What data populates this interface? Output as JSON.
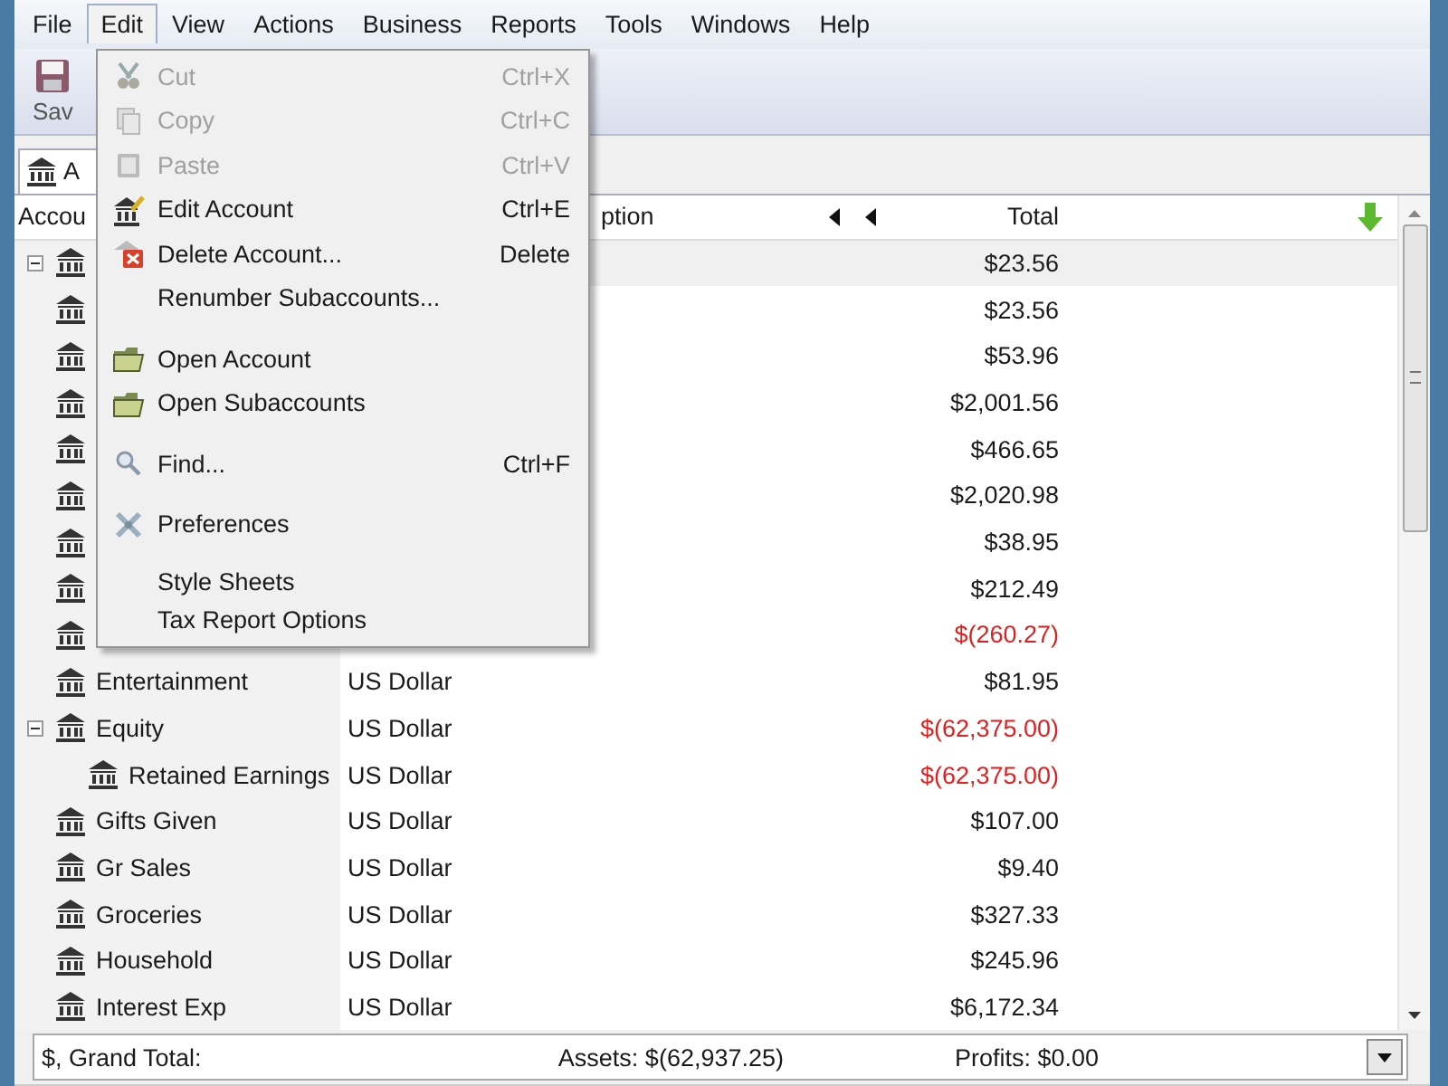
{
  "menubar": [
    {
      "label": "File",
      "selected": false
    },
    {
      "label": "Edit",
      "selected": true
    },
    {
      "label": "View",
      "selected": false
    },
    {
      "label": "Actions",
      "selected": false
    },
    {
      "label": "Business",
      "selected": false
    },
    {
      "label": "Reports",
      "selected": false
    },
    {
      "label": "Tools",
      "selected": false
    },
    {
      "label": "Windows",
      "selected": false
    },
    {
      "label": "Help",
      "selected": false
    }
  ],
  "toolbar": {
    "save_label": "Sav"
  },
  "tab": {
    "label": "A"
  },
  "columns": {
    "account": "Accou",
    "description": "ption",
    "total": "Total"
  },
  "accounts": [
    {
      "total": "$23.56",
      "negative": false,
      "selected": true,
      "expanded": true
    },
    {
      "total": "$23.56",
      "negative": false,
      "selected": false
    },
    {
      "total": "$53.96",
      "negative": false,
      "selected": false
    },
    {
      "total": "$2,001.56",
      "negative": false,
      "selected": false
    },
    {
      "total": "$466.65",
      "negative": false,
      "selected": false
    },
    {
      "total": "$2,020.98",
      "negative": false,
      "selected": false
    },
    {
      "total": "$38.95",
      "negative": false,
      "selected": false
    },
    {
      "total": "$212.49",
      "negative": false,
      "selected": false
    },
    {
      "total": "$(260.27)",
      "negative": true,
      "selected": false
    },
    {
      "name": "Entertainment",
      "commodity": "US Dollar",
      "total": "$81.95",
      "negative": false,
      "selected": false
    },
    {
      "name": "Equity",
      "commodity": "US Dollar",
      "total": "$(62,375.00)",
      "negative": true,
      "selected": false,
      "expanded": true,
      "children": [
        {
          "name": "Retained Earnings",
          "commodity": "US Dollar",
          "total": "$(62,375.00)",
          "negative": true,
          "selected": false
        }
      ]
    },
    {
      "name": "Gifts Given",
      "commodity": "US Dollar",
      "total": "$107.00",
      "negative": false,
      "selected": false
    },
    {
      "name": "Gr Sales",
      "commodity": "US Dollar",
      "total": "$9.40",
      "negative": false,
      "selected": false
    },
    {
      "name": "Groceries",
      "commodity": "US Dollar",
      "total": "$327.33",
      "negative": false,
      "selected": false
    },
    {
      "name": "Household",
      "commodity": "US Dollar",
      "total": "$245.96",
      "negative": false,
      "selected": false
    },
    {
      "name": "Interest Exp",
      "commodity": "US Dollar",
      "total": "$6,172.34",
      "negative": false,
      "selected": false
    }
  ],
  "summary": {
    "label": "$, Grand Total:",
    "assets": "Assets: $(62,937.25)",
    "profits": "Profits: $0.00"
  },
  "edit_menu": [
    {
      "kind": "item",
      "label": "Cut",
      "shortcut": "Ctrl+X",
      "disabled": true
    },
    {
      "kind": "item",
      "label": "Copy",
      "shortcut": "Ctrl+C",
      "disabled": true
    },
    {
      "kind": "item",
      "label": "Paste",
      "shortcut": "Ctrl+V",
      "disabled": true
    },
    {
      "kind": "item",
      "label": "Edit Account",
      "shortcut": "Ctrl+E",
      "disabled": false
    },
    {
      "kind": "item",
      "label": "Delete Account...",
      "shortcut": "Delete",
      "disabled": false
    },
    {
      "kind": "item",
      "label": "Renumber Subaccounts...",
      "disabled": false
    },
    {
      "kind": "separator"
    },
    {
      "kind": "item",
      "label": "Open Account",
      "disabled": false
    },
    {
      "kind": "item",
      "label": "Open Subaccounts",
      "disabled": false
    },
    {
      "kind": "separator"
    },
    {
      "kind": "item",
      "label": "Find...",
      "shortcut": "Ctrl+F",
      "disabled": false
    },
    {
      "kind": "separator"
    },
    {
      "kind": "item",
      "label": "Preferences",
      "disabled": false
    },
    {
      "kind": "separator"
    },
    {
      "kind": "item",
      "label": "Style Sheets",
      "disabled": false,
      "compact": true
    },
    {
      "kind": "item",
      "label": "Tax Report Options",
      "disabled": false,
      "compact": true
    }
  ]
}
